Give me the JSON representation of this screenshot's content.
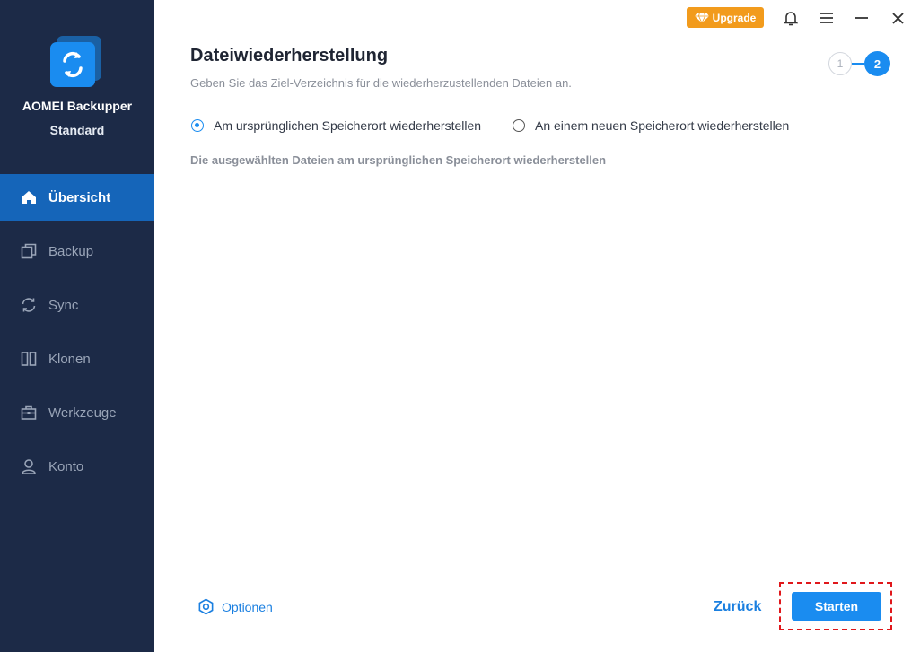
{
  "app": {
    "name": "AOMEI Backupper",
    "edition": "Standard"
  },
  "sidebar": {
    "items": [
      {
        "label": "Übersicht",
        "icon": "home-icon",
        "active": true
      },
      {
        "label": "Backup",
        "icon": "backup-icon",
        "active": false
      },
      {
        "label": "Sync",
        "icon": "sync-icon",
        "active": false
      },
      {
        "label": "Klonen",
        "icon": "clone-icon",
        "active": false
      },
      {
        "label": "Werkzeuge",
        "icon": "toolbox-icon",
        "active": false
      },
      {
        "label": "Konto",
        "icon": "user-icon",
        "active": false
      }
    ]
  },
  "topbar": {
    "upgrade_label": "Upgrade",
    "icons": [
      "bell-icon",
      "menu-icon",
      "minimize-icon",
      "close-icon"
    ]
  },
  "page": {
    "title": "Dateiwiederherstellung",
    "subtitle": "Geben Sie das Ziel-Verzeichnis für die wiederherzustellenden Dateien an.",
    "steps": {
      "step1": "1",
      "step2": "2",
      "current": 2
    },
    "radio_original": "Am ursprünglichen Speicherort wiederherstellen",
    "radio_new": "An einem neuen Speicherort wiederherstellen",
    "selected_option": "original",
    "description": "Die ausgewählten Dateien am ursprünglichen Speicherort wiederherstellen"
  },
  "footer": {
    "options_label": "Optionen",
    "back_label": "Zurück",
    "start_label": "Starten"
  },
  "colors": {
    "sidebar_bg": "#1c2a47",
    "active_nav": "#1565b9",
    "accent": "#1a8cf0",
    "upgrade": "#f29b1c",
    "highlight": "#e0171b"
  }
}
